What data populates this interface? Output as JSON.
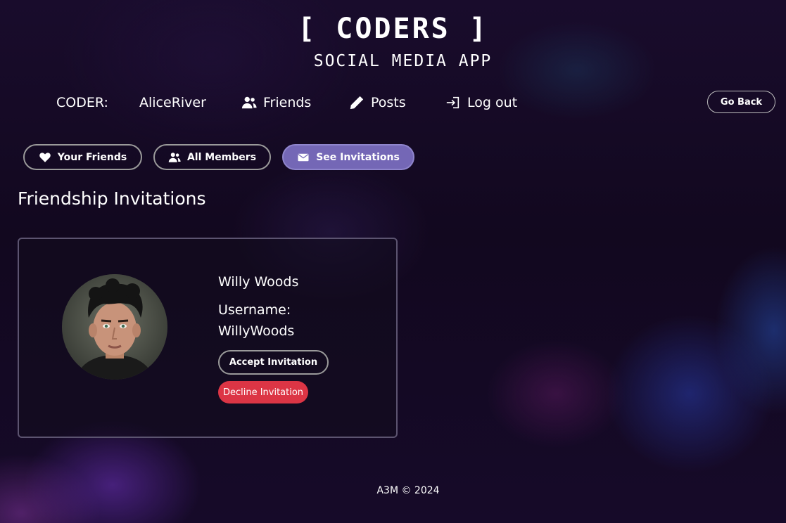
{
  "header": {
    "title": "[ CODERS ]",
    "subtitle": "SOCIAL MEDIA APP"
  },
  "nav": {
    "coder_label": "CODER:",
    "username": "AliceRiver",
    "friends": {
      "label": "Friends",
      "icon": "users-icon"
    },
    "posts": {
      "label": "Posts",
      "icon": "pencil-icon"
    },
    "logout": {
      "label": "Log out",
      "icon": "sign-out-icon"
    },
    "go_back": "Go Back"
  },
  "tabs": [
    {
      "label": "Your Friends",
      "icon": "heart-icon",
      "active": false
    },
    {
      "label": "All Members",
      "icon": "users-icon",
      "active": false
    },
    {
      "label": "See Invitations",
      "icon": "envelope-icon",
      "active": true
    }
  ],
  "section_title": "Friendship Invitations",
  "invitations": [
    {
      "name": "Willy Woods",
      "username_label": "Username:",
      "username": "WillyWoods",
      "accept_label": "Accept Invitation",
      "decline_label": "Decline Invitation"
    }
  ],
  "footer": "A3M © 2024",
  "colors": {
    "active_tab": "#7467b6",
    "decline": "#dc3545",
    "background": "#140a24"
  }
}
